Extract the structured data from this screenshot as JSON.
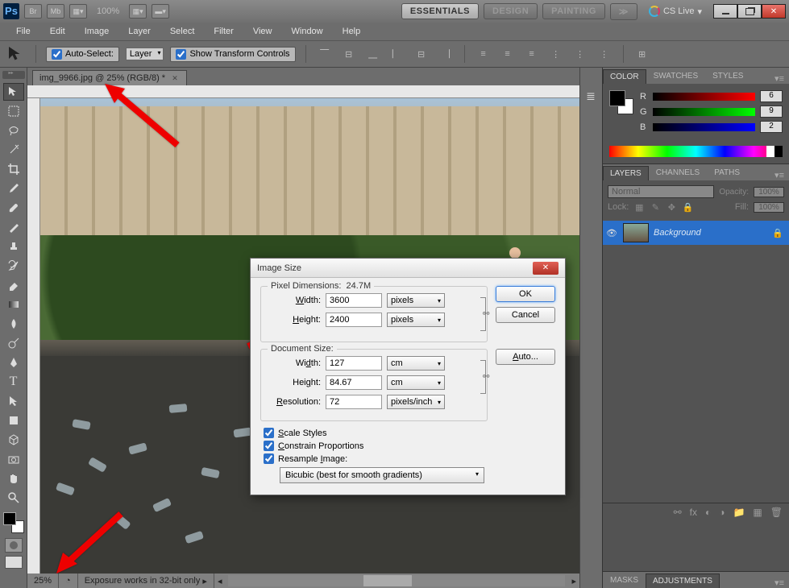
{
  "titlebar": {
    "zoom": "100%",
    "workspaces": {
      "essentials": "ESSENTIALS",
      "design": "DESIGN",
      "painting": "PAINTING"
    },
    "cslive": "CS Live"
  },
  "menubar": [
    "File",
    "Edit",
    "Image",
    "Layer",
    "Select",
    "Filter",
    "View",
    "Window",
    "Help"
  ],
  "options": {
    "auto_select": "Auto-Select:",
    "auto_select_value": "Layer",
    "show_transform": "Show Transform Controls"
  },
  "document": {
    "tab": "img_9966.jpg @ 25% (RGB/8) *",
    "status_zoom": "25%",
    "status_msg": "Exposure works in 32-bit only"
  },
  "dialog": {
    "title": "Image Size",
    "ok": "OK",
    "cancel": "Cancel",
    "auto": "Auto...",
    "pixel_dims": "Pixel Dimensions:",
    "pixel_dims_val": "24.7M",
    "width_l": "Width:",
    "height_l": "Height:",
    "resolution_l": "Resolution:",
    "px_width": "3600",
    "px_height": "2400",
    "px_unit": "pixels",
    "doc_size": "Document Size:",
    "doc_width": "127",
    "doc_height": "84.67",
    "doc_unit": "cm",
    "resolution": "72",
    "res_unit": "pixels/inch",
    "scale_styles": "Scale Styles",
    "constrain": "Constrain Proportions",
    "resample": "Resample Image:",
    "resample_method": "Bicubic (best for smooth gradients)"
  },
  "panels": {
    "color": {
      "tab_color": "COLOR",
      "tab_swatch": "SWATCHES",
      "tab_styles": "STYLES",
      "r": "6",
      "g": "9",
      "b": "2"
    },
    "layers": {
      "tab_layers": "LAYERS",
      "tab_channels": "CHANNELS",
      "tab_paths": "PATHS",
      "blend": "Normal",
      "opacity_l": "Opacity:",
      "opacity": "100%",
      "lock_l": "Lock:",
      "fill_l": "Fill:",
      "fill": "100%",
      "bg_layer": "Background"
    },
    "bottom": {
      "masks": "MASKS",
      "adjust": "ADJUSTMENTS"
    }
  }
}
